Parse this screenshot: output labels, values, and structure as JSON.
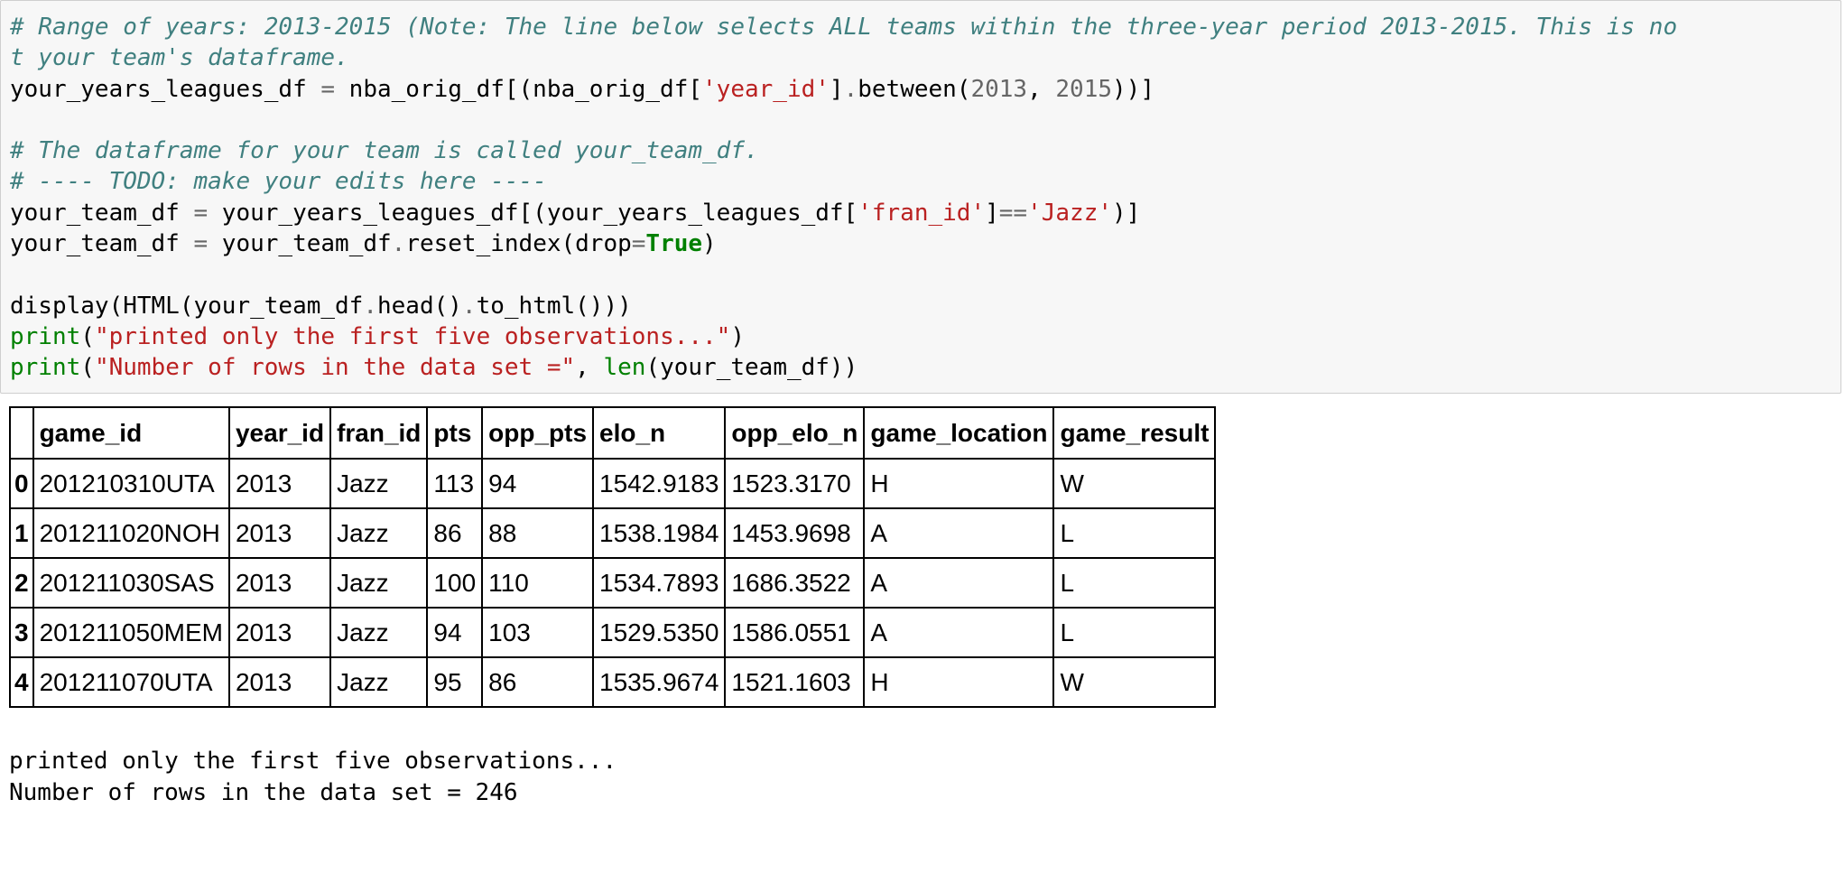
{
  "code": {
    "line1_comment": "# Range of years: 2013-2015 (Note: The line below selects ALL teams within the three-year period 2013-2015. This is no",
    "line2_comment": "t your team's dataframe.",
    "line3": {
      "a": "your_years_leagues_df ",
      "eq": "=",
      "b": " nba_orig_df[(nba_orig_df[",
      "str": "'year_id'",
      "c": "]",
      "dot": ".",
      "d": "between(",
      "num1": "2013",
      "e": ", ",
      "num2": "2015",
      "f": "))]"
    },
    "line5_comment": "# The dataframe for your team is called your_team_df.",
    "line6_comment": "# ---- TODO: make your edits here ----",
    "line7": {
      "a": "your_team_df ",
      "eq": "=",
      "b": " your_years_leagues_df[(your_years_leagues_df[",
      "str1": "'fran_id'",
      "c": "]",
      "eqeq": "==",
      "str2": "'Jazz'",
      "d": ")]"
    },
    "line8": {
      "a": "your_team_df ",
      "eq": "=",
      "b": " your_team_df",
      "dot": ".",
      "c": "reset_index(drop",
      "eq2": "=",
      "kw": "True",
      "d": ")"
    },
    "line10": {
      "a": "display(HTML(your_team_df",
      "dot1": ".",
      "b": "head()",
      "dot2": ".",
      "c": "to_html()))"
    },
    "line11": {
      "fn": "print",
      "a": "(",
      "str": "\"printed only the first five observations...\"",
      "b": ")"
    },
    "line12": {
      "fn": "print",
      "a": "(",
      "str": "\"Number of rows in the data set =\"",
      "b": ", ",
      "fn2": "len",
      "c": "(your_team_df))"
    }
  },
  "table": {
    "index_header": "",
    "columns": [
      "game_id",
      "year_id",
      "fran_id",
      "pts",
      "opp_pts",
      "elo_n",
      "opp_elo_n",
      "game_location",
      "game_result"
    ],
    "rows": [
      {
        "index": "0",
        "cells": [
          "201210310UTA",
          "2013",
          "Jazz",
          "113",
          "94",
          "1542.9183",
          "1523.3170",
          "H",
          "W"
        ]
      },
      {
        "index": "1",
        "cells": [
          "201211020NOH",
          "2013",
          "Jazz",
          "86",
          "88",
          "1538.1984",
          "1453.9698",
          "A",
          "L"
        ]
      },
      {
        "index": "2",
        "cells": [
          "201211030SAS",
          "2013",
          "Jazz",
          "100",
          "110",
          "1534.7893",
          "1686.3522",
          "A",
          "L"
        ]
      },
      {
        "index": "3",
        "cells": [
          "201211050MEM",
          "2013",
          "Jazz",
          "94",
          "103",
          "1529.5350",
          "1586.0551",
          "A",
          "L"
        ]
      },
      {
        "index": "4",
        "cells": [
          "201211070UTA",
          "2013",
          "Jazz",
          "95",
          "86",
          "1535.9674",
          "1521.1603",
          "H",
          "W"
        ]
      }
    ]
  },
  "stdout": {
    "line1": "printed only the first five observations...",
    "line2": "Number of rows in the data set = 246"
  },
  "colors": {
    "comment": "#408080",
    "string": "#ba2121",
    "number": "#666666",
    "builtin": "#008000",
    "cell_background": "#f7f7f7"
  }
}
